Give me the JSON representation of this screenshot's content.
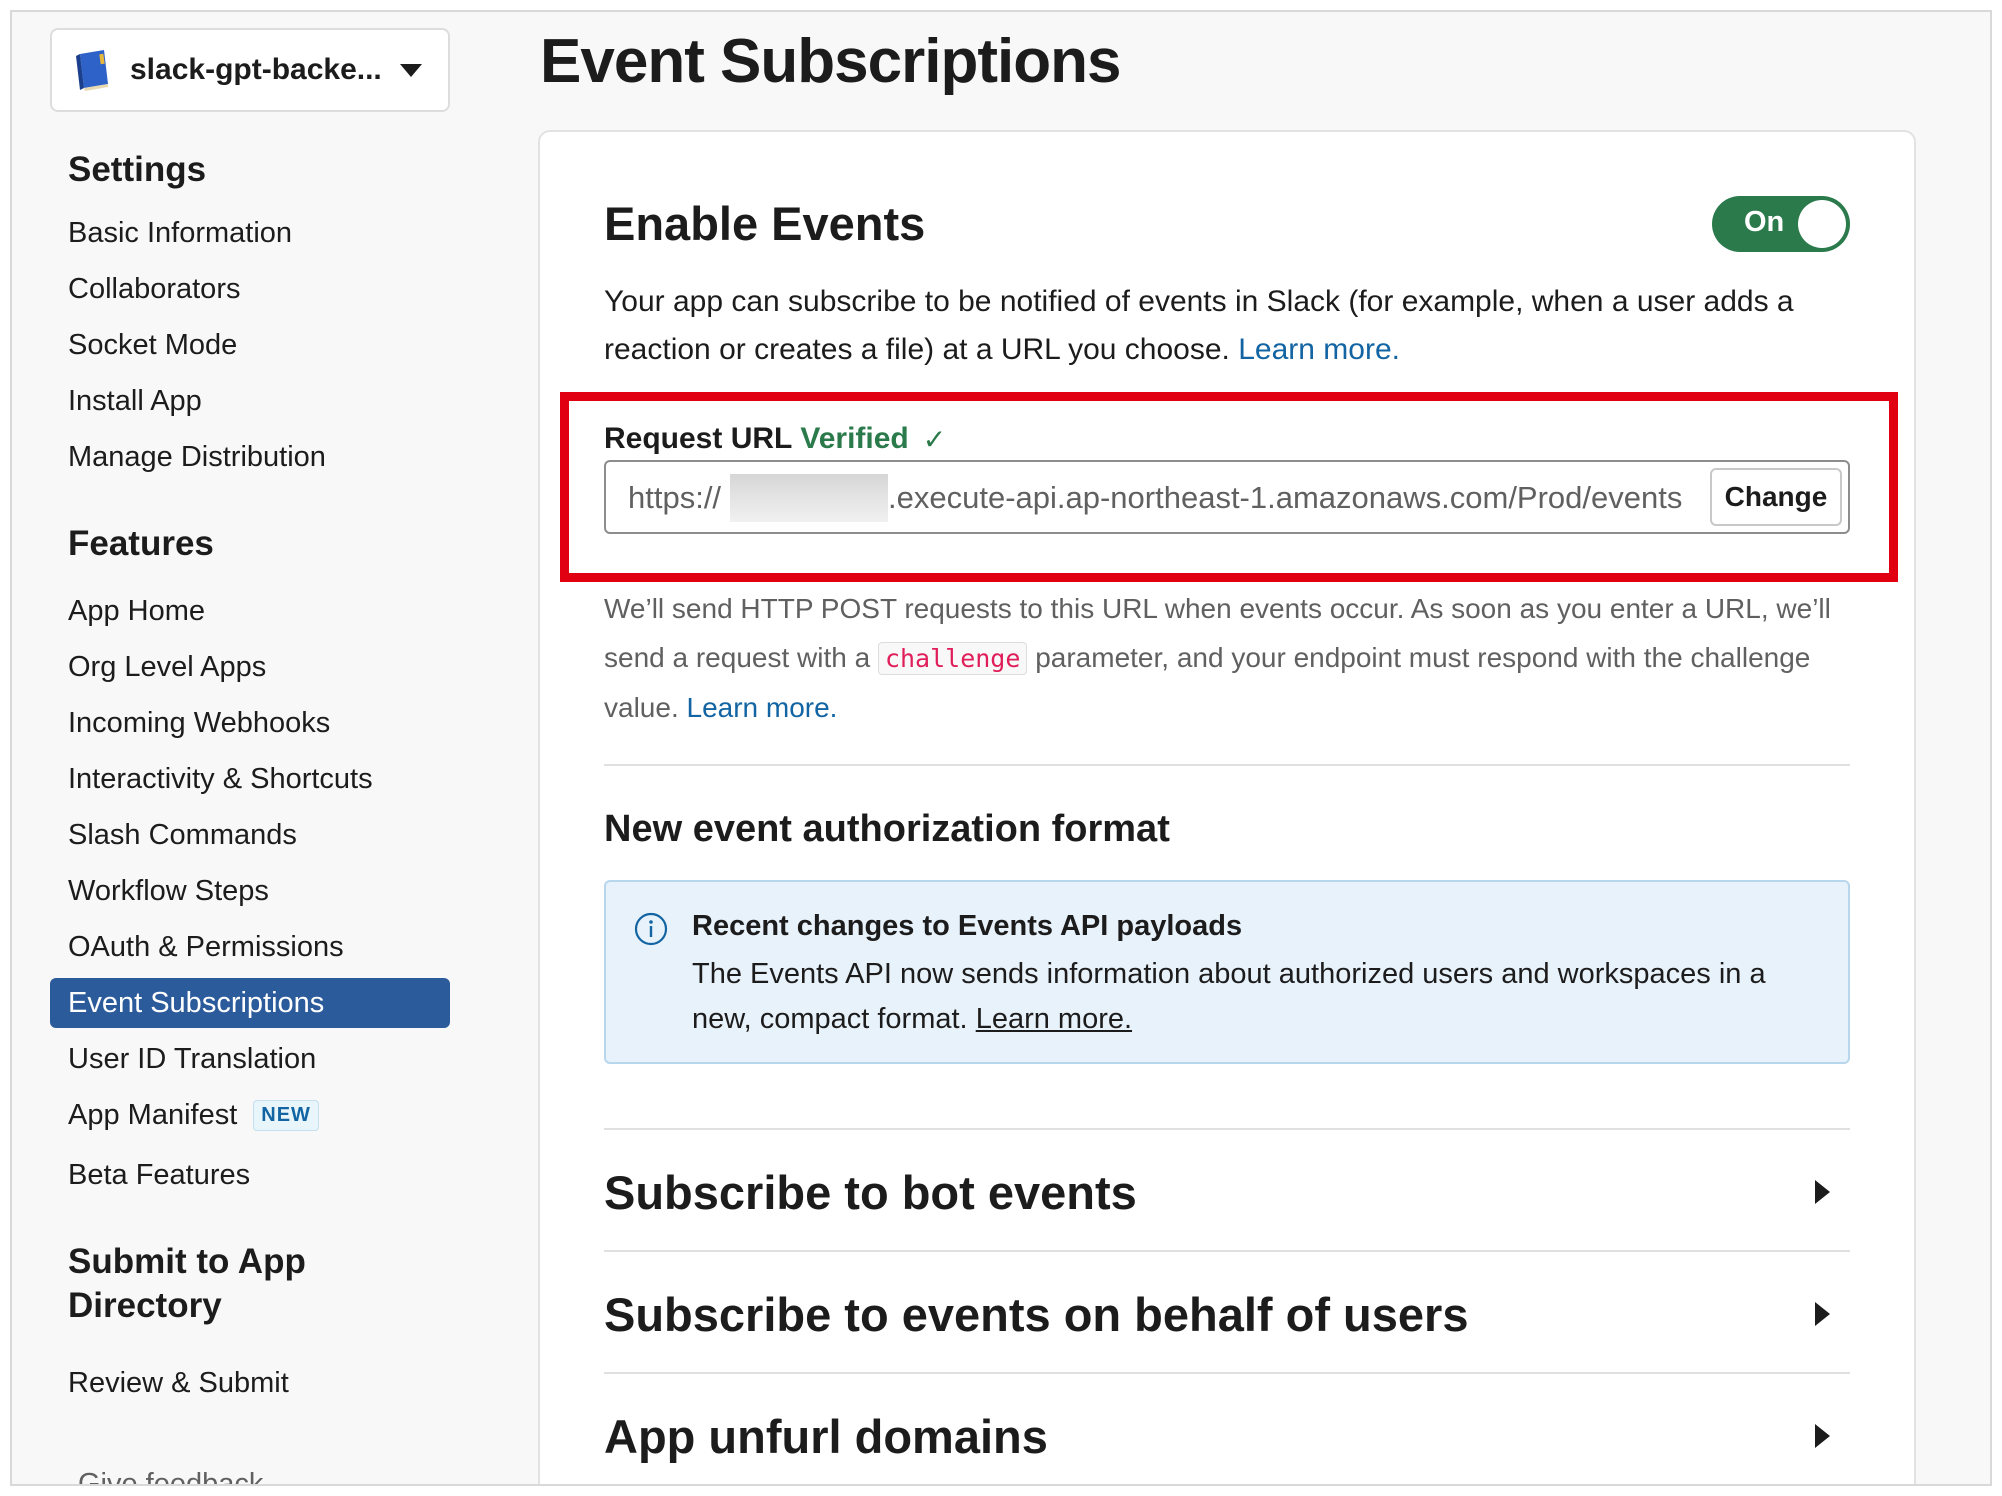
{
  "app": {
    "name": "slack-gpt-backe...",
    "icon": "book-icon"
  },
  "sidebar": {
    "sections": [
      {
        "heading": "Settings",
        "items": [
          "Basic Information",
          "Collaborators",
          "Socket Mode",
          "Install App",
          "Manage Distribution"
        ]
      },
      {
        "heading": "Features",
        "items": [
          "App Home",
          "Org Level Apps",
          "Incoming Webhooks",
          "Interactivity & Shortcuts",
          "Slash Commands",
          "Workflow Steps",
          "OAuth & Permissions",
          "Event Subscriptions",
          "User ID Translation",
          "App Manifest",
          "Beta Features"
        ]
      },
      {
        "heading": "Submit to App Directory",
        "items": [
          "Review & Submit"
        ]
      }
    ],
    "active_item": "Event Subscriptions",
    "badge_new": "NEW",
    "feedback": "Give feedback"
  },
  "page": {
    "title": "Event Subscriptions"
  },
  "enable_events": {
    "title": "Enable Events",
    "toggle_label": "On",
    "description": "Your app can subscribe to be notified of events in Slack (for example, when a user adds a reaction or creates a file) at a URL you choose.",
    "learn_more": "Learn more."
  },
  "request_url": {
    "label": "Request URL",
    "status": "Verified",
    "check": "✓",
    "prefix": "https://",
    "rest": ".execute-api.ap-northeast-1.amazonaws.com/Prod/events",
    "change_button": "Change",
    "help_before": "We’ll send HTTP POST requests to this URL when events occur. As soon as you enter a URL, we’ll send a request with a",
    "help_code": "challenge",
    "help_after": "parameter, and your endpoint must respond with the challenge value.",
    "help_learn_more": "Learn more."
  },
  "auth_format": {
    "title": "New event authorization format",
    "info_title": "Recent changes to Events API payloads",
    "info_body": "The Events API now sends information about authorized users and workspaces in a new, compact format.",
    "info_link": "Learn more."
  },
  "expanders": [
    {
      "label": "Subscribe to bot events"
    },
    {
      "label": "Subscribe to events on behalf of users"
    },
    {
      "label": "App unfurl domains"
    }
  ],
  "colors": {
    "accent": "#2c5b9c",
    "toggle_on": "#2b7a4b",
    "link": "#1264a3",
    "highlight": "#e00012",
    "code": "#e01e5a"
  }
}
